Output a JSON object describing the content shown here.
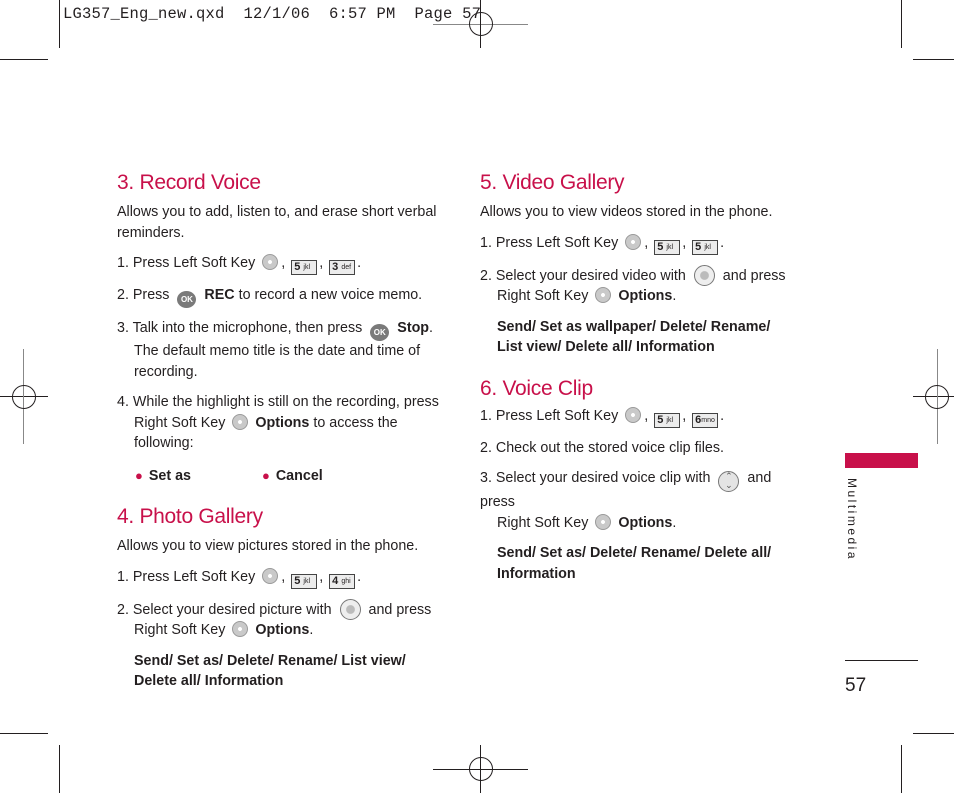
{
  "slug": {
    "text": "LG357_Eng_new.qxd  12/1/06  6:57 PM  Page 57"
  },
  "side_tab": {
    "label": "Multimedia",
    "accent_color": "#c8104a"
  },
  "page_number": "57",
  "sections": {
    "record_voice": {
      "title": "3. Record Voice",
      "intro": "Allows you to add, listen to, and erase short verbal reminders.",
      "step1_prefix": "1. Press Left Soft Key",
      "step1_keys": [
        {
          "num": "5",
          "letters": "jkl"
        },
        {
          "num": "3",
          "letters": "def"
        }
      ],
      "step2_prefix": "2. Press",
      "step2_ok": "OK",
      "step2_bold": "REC",
      "step2_suffix": "to record a new voice memo.",
      "step3_prefix": "3. Talk into the microphone, then press",
      "step3_ok": "OK",
      "step3_bold": "Stop",
      "step3_cont": "The default memo title is the date and time of recording.",
      "step4_line1": "4. While the highlight is still on the recording, press",
      "step4_prefix": "Right Soft Key",
      "step4_bold": "Options",
      "step4_suffix": "to access the following:",
      "bullets": [
        "Set as",
        "Cancel"
      ]
    },
    "photo_gallery": {
      "title": "4. Photo Gallery",
      "intro": "Allows you to view pictures stored in the phone.",
      "step1_prefix": "1. Press Left Soft Key",
      "step1_keys": [
        {
          "num": "5",
          "letters": "jkl"
        },
        {
          "num": "4",
          "letters": "ghi"
        }
      ],
      "step2_prefix": "2. Select your desired picture with",
      "step2_suffix": "and press",
      "step2_line2_prefix": "Right Soft Key",
      "step2_bold": "Options",
      "options": "Send/ Set as/ Delete/ Rename/ List view/ Delete all/ Information"
    },
    "video_gallery": {
      "title": "5. Video Gallery",
      "intro": "Allows you to view videos stored in the phone.",
      "step1_prefix": "1. Press Left Soft Key",
      "step1_keys": [
        {
          "num": "5",
          "letters": "jkl"
        },
        {
          "num": "5",
          "letters": "jkl"
        }
      ],
      "step2_prefix": "2. Select your desired video with",
      "step2_suffix": "and press",
      "step2_line2_prefix": "Right Soft Key",
      "step2_bold": "Options",
      "options": "Send/ Set as wallpaper/ Delete/ Rename/ List view/ Delete all/ Information"
    },
    "voice_clip": {
      "title": "6. Voice Clip",
      "step1_prefix": "1. Press Left Soft Key",
      "step1_keys": [
        {
          "num": "5",
          "letters": "jkl"
        },
        {
          "num": "6",
          "letters": "mno"
        }
      ],
      "step2": "2. Check out the stored voice clip files.",
      "step3_prefix": "3. Select your desired voice clip with",
      "step3_suffix": "and press",
      "step3_line2_prefix": "Right Soft Key",
      "step3_bold": "Options",
      "options": "Send/ Set as/ Delete/ Rename/ Delete all/ Information"
    }
  }
}
